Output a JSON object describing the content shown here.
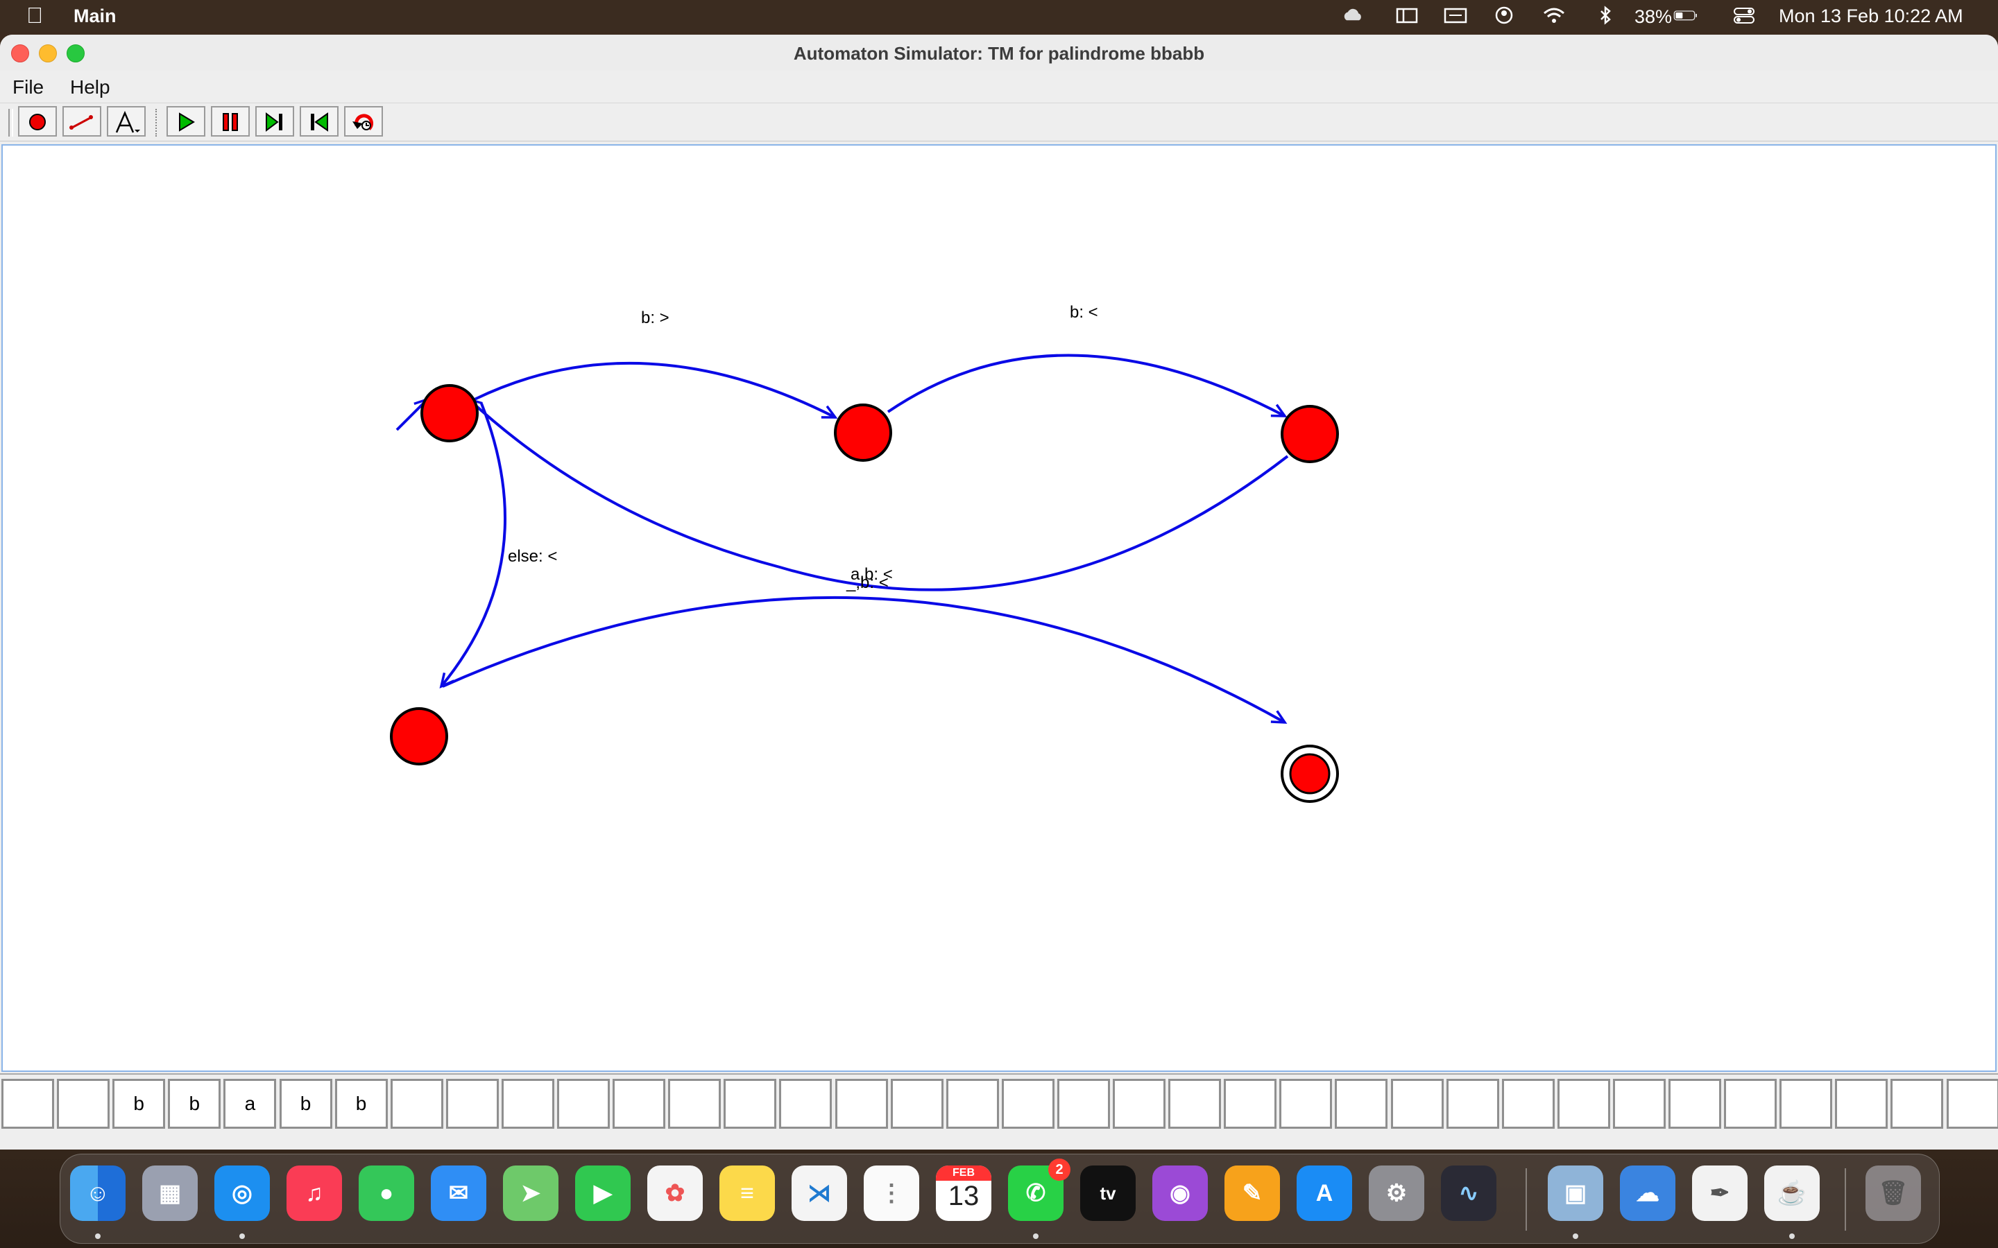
{
  "menubar": {
    "app_name": "Main",
    "battery": "38%",
    "clock": "Mon 13 Feb  10:22 AM"
  },
  "window": {
    "title": "Automaton Simulator: TM for palindrome bbabb",
    "menu": [
      "File",
      "Help"
    ]
  },
  "toolbar": {
    "tools": [
      "state-tool",
      "transition-tool",
      "text-tool"
    ],
    "controls": [
      "play",
      "pause",
      "step",
      "rewind",
      "reset"
    ]
  },
  "automaton": {
    "states": [
      {
        "id": "q0",
        "initial": true,
        "accepting": false
      },
      {
        "id": "q1",
        "initial": false,
        "accepting": false
      },
      {
        "id": "q2",
        "initial": false,
        "accepting": false
      },
      {
        "id": "q3",
        "initial": false,
        "accepting": false
      },
      {
        "id": "q4",
        "initial": false,
        "accepting": true
      }
    ],
    "transitions": [
      {
        "from": "q0",
        "to": "q1",
        "label": "b: >"
      },
      {
        "from": "q1",
        "to": "q2",
        "label": "b: <"
      },
      {
        "from": "q2",
        "to": "q0",
        "label": "a,b: <"
      },
      {
        "from": "q0",
        "to": "q3",
        "label": "else: <"
      },
      {
        "from": "q3",
        "to": "q4",
        "label": "_,b: <"
      }
    ]
  },
  "tape": {
    "cells": [
      "",
      "",
      "b",
      "b",
      "a",
      "b",
      "b",
      "",
      "",
      "",
      "",
      "",
      "",
      "",
      "",
      "",
      "",
      "",
      "",
      "",
      "",
      "",
      "",
      "",
      "",
      "",
      "",
      "",
      "",
      "",
      "",
      "",
      "",
      "",
      "",
      "",
      ""
    ]
  },
  "dock": {
    "calendar_month": "FEB",
    "calendar_day": "13",
    "whatsapp_badge": "2",
    "tv_label": "tv"
  }
}
